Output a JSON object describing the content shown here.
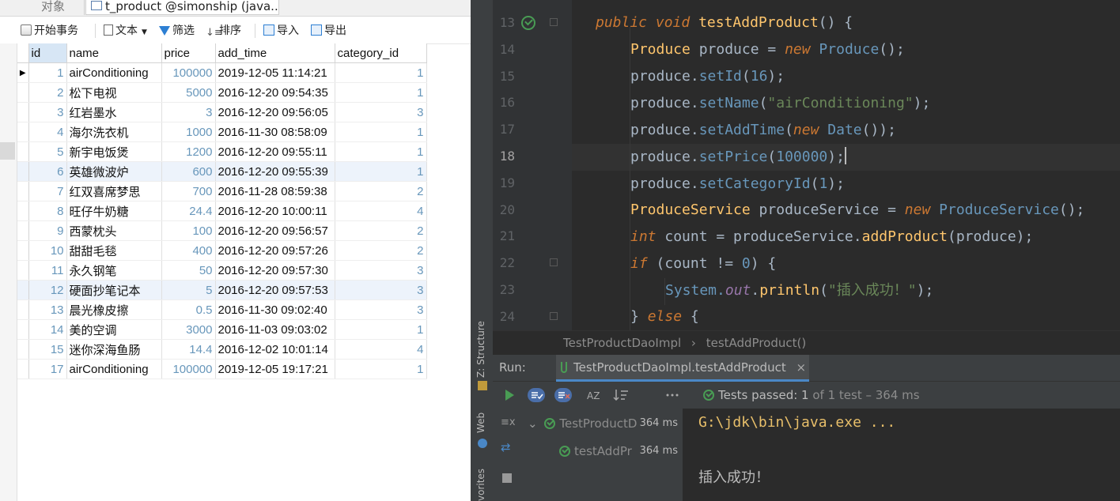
{
  "navicat": {
    "tabs": [
      {
        "label": "对象"
      },
      {
        "label": "t_product @simonship (java..."
      }
    ],
    "toolbar": {
      "begin_transaction": "开始事务",
      "text": "文本",
      "filter": "筛选",
      "sort": "排序",
      "import": "导入",
      "export": "导出"
    },
    "columns": [
      "id",
      "name",
      "price",
      "add_time",
      "category_id"
    ],
    "rows": [
      {
        "id": "1",
        "name": "airConditioning",
        "price": "100000",
        "add_time": "2019-12-05 11:14:21",
        "category_id": "1"
      },
      {
        "id": "2",
        "name": "松下电视",
        "price": "5000",
        "add_time": "2016-12-20 09:54:35",
        "category_id": "1"
      },
      {
        "id": "3",
        "name": "红岩墨水",
        "price": "3",
        "add_time": "2016-12-20 09:56:05",
        "category_id": "3"
      },
      {
        "id": "4",
        "name": "海尔洗衣机",
        "price": "1000",
        "add_time": "2016-11-30 08:58:09",
        "category_id": "1"
      },
      {
        "id": "5",
        "name": "新宇电饭煲",
        "price": "1200",
        "add_time": "2016-12-20 09:55:11",
        "category_id": "1"
      },
      {
        "id": "6",
        "name": "英雄微波炉",
        "price": "600",
        "add_time": "2016-12-20 09:55:39",
        "category_id": "1"
      },
      {
        "id": "7",
        "name": "红双喜席梦思",
        "price": "700",
        "add_time": "2016-11-28 08:59:38",
        "category_id": "2"
      },
      {
        "id": "8",
        "name": "旺仔牛奶糖",
        "price": "24.4",
        "add_time": "2016-12-20 10:00:11",
        "category_id": "4"
      },
      {
        "id": "9",
        "name": "西蒙枕头",
        "price": "100",
        "add_time": "2016-12-20 09:56:57",
        "category_id": "2"
      },
      {
        "id": "10",
        "name": "甜甜毛毯",
        "price": "400",
        "add_time": "2016-12-20 09:57:26",
        "category_id": "2"
      },
      {
        "id": "11",
        "name": "永久钢笔",
        "price": "50",
        "add_time": "2016-12-20 09:57:30",
        "category_id": "3"
      },
      {
        "id": "12",
        "name": "硬面抄笔记本",
        "price": "5",
        "add_time": "2016-12-20 09:57:53",
        "category_id": "3"
      },
      {
        "id": "13",
        "name": "晨光橡皮擦",
        "price": "0.5",
        "add_time": "2016-11-30 09:02:40",
        "category_id": "3"
      },
      {
        "id": "14",
        "name": "美的空调",
        "price": "3000",
        "add_time": "2016-11-03 09:03:02",
        "category_id": "1"
      },
      {
        "id": "15",
        "name": "迷你深海鱼肠",
        "price": "14.4",
        "add_time": "2016-12-02 10:01:14",
        "category_id": "4"
      },
      {
        "id": "17",
        "name": "airConditioning",
        "price": "100000",
        "add_time": "2019-12-05 19:17:21",
        "category_id": "1"
      }
    ]
  },
  "ide": {
    "sidebar_tabs": {
      "structure": "Z: Structure",
      "web": "Web",
      "favorites": "vorites"
    },
    "line_numbers": [
      "13",
      "14",
      "15",
      "16",
      "17",
      "18",
      "19",
      "20",
      "21",
      "22",
      "23",
      "24"
    ],
    "code": {
      "l13": {
        "kw1": "public",
        "kw2": "void",
        "fn": "testAddProduct",
        "rest": "() {"
      },
      "l14": {
        "type": "Produce",
        "var": " produce = ",
        "kw": "new",
        "cls": " Produce",
        "rest": "();"
      },
      "l15": {
        "obj": "produce.",
        "m": "setId",
        "p1": "(",
        "num": "16",
        "p2": ");"
      },
      "l16": {
        "obj": "produce.",
        "m": "setName",
        "p1": "(",
        "str": "\"airConditioning\"",
        "p2": ");"
      },
      "l17": {
        "obj": "produce.",
        "m": "setAddTime",
        "p1": "(",
        "kw": "new",
        "cls": " Date",
        "p2": "());"
      },
      "l18": {
        "obj": "produce.",
        "m": "setPrice",
        "p1": "(",
        "num": "100000",
        "p2": ");"
      },
      "l19": {
        "obj": "produce.",
        "m": "setCategoryId",
        "p1": "(",
        "num": "1",
        "p2": ");"
      },
      "l20": {
        "type": "ProduceService",
        "var": " produceService = ",
        "kw": "new",
        "cls": " ProduceService",
        "rest": "();"
      },
      "l21": {
        "kw": "int",
        "var": " count = produceService.",
        "m": "addProduct",
        "rest": "(produce);"
      },
      "l22": {
        "kw": "if",
        "p1": " (count != ",
        "num": "0",
        "rest": ") {"
      },
      "l23": {
        "obj": "System.",
        "st": "out",
        "dot": ".",
        "m": "println",
        "p1": "(",
        "str": "\"插入成功！\"",
        "p2": ");"
      },
      "l24": {
        "p1": "} ",
        "kw": "else",
        "rest": " {"
      }
    },
    "breadcrumb": {
      "class": "TestProductDaoImpl",
      "sep": "›",
      "method": "testAddProduct()"
    },
    "run": {
      "label": "Run:",
      "tab": "TestProductDaoImpl.testAddProduct",
      "tab_close": "×",
      "status_strong": "Tests passed: 1",
      "status_dim": " of 1 test – 364 ms"
    },
    "tree": [
      {
        "label": "TestProductD",
        "time": "364 ms"
      },
      {
        "label": "testAddPr",
        "time": "364 ms"
      }
    ],
    "console": {
      "cmd": "G:\\jdk\\bin\\java.exe ...",
      "output": "插入成功！"
    }
  }
}
